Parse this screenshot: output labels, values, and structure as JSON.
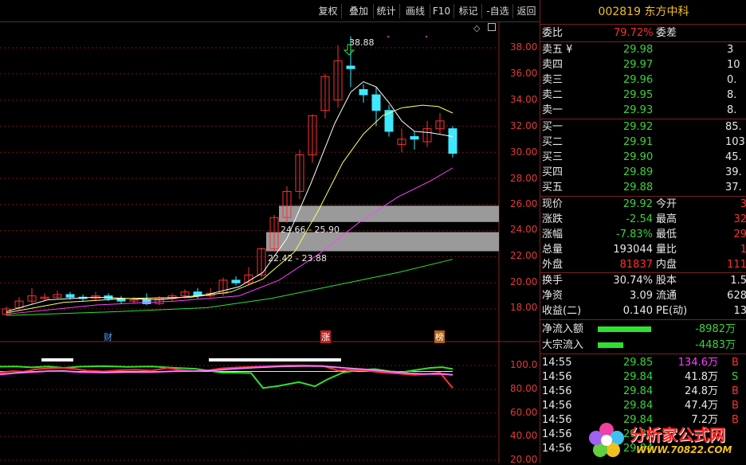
{
  "toolbar": {
    "buttons": [
      "复权",
      "叠加",
      "统计",
      "画线",
      "F10",
      "标记",
      "-自选",
      "返回"
    ]
  },
  "chart": {
    "y_ticks": [
      "38.00",
      "36.00",
      "34.00",
      "32.00",
      "30.00",
      "28.00",
      "26.00",
      "24.00",
      "22.00",
      "20.00",
      "18.00"
    ],
    "sub_y_ticks": [
      "100.0",
      "80.00",
      "60.00",
      "40.00",
      "20.00"
    ],
    "high_label": "38.88",
    "zone_upper_label": "24.66 - 25.90",
    "zone_lower_label": "22.42 - 23.88",
    "marker_cai": "财",
    "marker_zhang": "涨",
    "marker_bang": "榜",
    "colors": {
      "up": "#ff3030",
      "down": "#40e8ff",
      "ma5": "#ffffff",
      "ma10": "#ffff60",
      "ma20": "#ff40ff",
      "ma60": "#30e030"
    }
  },
  "panel": {
    "title": "002819 东方中科",
    "weibi_label": "委比",
    "weibi_value": "79.72%",
    "weicha_label": "委差",
    "sells": [
      {
        "label": "卖五 ¥",
        "price": "29.98",
        "vol": "3"
      },
      {
        "label": "卖四",
        "price": "29.97",
        "vol": "10"
      },
      {
        "label": "卖三",
        "price": "29.96",
        "vol": "0."
      },
      {
        "label": "卖二",
        "price": "29.95",
        "vol": "8."
      },
      {
        "label": "卖一",
        "price": "29.93",
        "vol": "8."
      }
    ],
    "buys": [
      {
        "label": "买一",
        "price": "29.92",
        "vol": "85."
      },
      {
        "label": "买二",
        "price": "29.91",
        "vol": "103"
      },
      {
        "label": "买三",
        "price": "29.90",
        "vol": "45."
      },
      {
        "label": "买四",
        "price": "29.89",
        "vol": "39."
      },
      {
        "label": "买五",
        "price": "29.88",
        "vol": "37."
      }
    ],
    "quote": [
      {
        "l1": "现价",
        "v1": "29.92",
        "c1": "cg",
        "l2": "今开",
        "v2": "3"
      },
      {
        "l1": "涨跌",
        "v1": "-2.54",
        "c1": "cg",
        "l2": "最高",
        "v2": "32"
      },
      {
        "l1": "涨幅",
        "v1": "-7.83%",
        "c1": "cg",
        "l2": "最低",
        "v2": "29"
      },
      {
        "l1": "总量",
        "v1": "193044",
        "c1": "cw",
        "l2": "量比",
        "v2": "1"
      },
      {
        "l1": "外盘",
        "v1": "81837",
        "c1": "cr",
        "l2": "内盘",
        "v2": "111"
      }
    ],
    "stats": [
      {
        "l1": "换手",
        "v1": "30.74%",
        "l2": "股本",
        "v2": "1.5"
      },
      {
        "l1": "净资",
        "v1": "3.09",
        "l2": "流通",
        "v2": "628"
      },
      {
        "l1": "收益(二)",
        "v1": "0.140",
        "l2": "PE(动)",
        "v2": "13"
      }
    ],
    "flows": [
      {
        "label": "净流入额",
        "value": "-8982万",
        "bar": 0.95
      },
      {
        "label": "大宗流入",
        "value": "-4483万",
        "bar": 0.45
      }
    ],
    "ticks": [
      {
        "time": "14:55",
        "price": "29.85",
        "vol": "134.6万",
        "bs": "B",
        "volc": "cm"
      },
      {
        "time": "14:56",
        "price": "29.84",
        "vol": "41.8万",
        "bs": "S",
        "volc": "cw"
      },
      {
        "time": "14:56",
        "price": "29.84",
        "vol": "24.8万",
        "bs": "B",
        "volc": "cw"
      },
      {
        "time": "14:56",
        "price": "29.84",
        "vol": "47.4万",
        "bs": "B",
        "volc": "cw"
      },
      {
        "time": "14:56",
        "price": "29.84",
        "vol": "7.2万",
        "bs": "B",
        "volc": "cw"
      },
      {
        "time": "14:56",
        "price": "29.84",
        "vol": "",
        "bs": "",
        "volc": "cw"
      },
      {
        "time": "14:56",
        "price": "29.84",
        "vol": "",
        "bs": "",
        "volc": "cw"
      }
    ]
  },
  "watermark": {
    "text": "分析家公式网",
    "url": "WWW.70822.COM"
  }
}
